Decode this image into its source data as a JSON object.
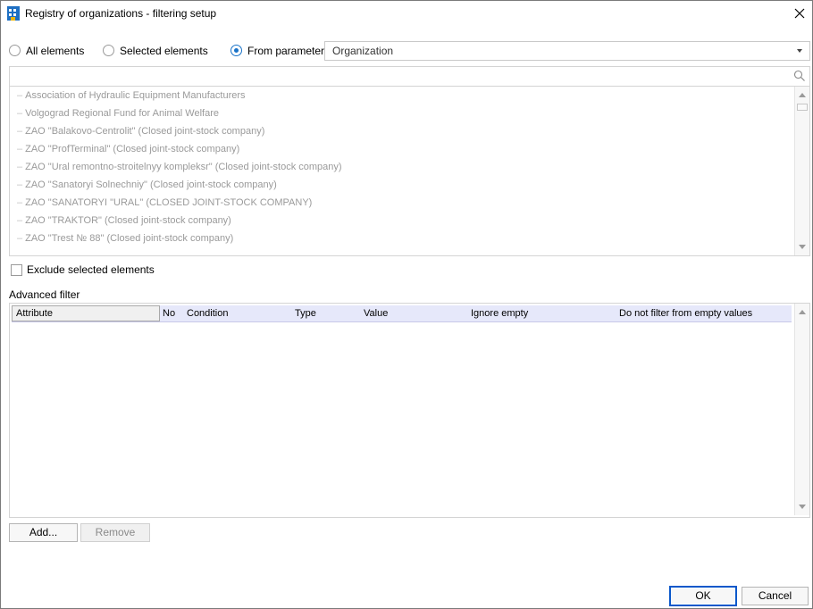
{
  "window": {
    "title": "Registry of organizations - filtering setup"
  },
  "selection_mode": {
    "options": [
      {
        "label": "All elements",
        "checked": false
      },
      {
        "label": "Selected elements",
        "checked": false
      },
      {
        "label": "From parameter:",
        "checked": true
      }
    ],
    "parameter_value": "Organization"
  },
  "search": {
    "placeholder": ""
  },
  "elements": [
    "Association of Hydraulic Equipment Manufacturers",
    "Volgograd Regional Fund for Animal Welfare",
    "ZAO \"Balakovo-Centrolit\" (Closed joint-stock company)",
    "ZAO \"ProfTerminal\" (Closed joint-stock company)",
    "ZAO \"Ural remontno-stroitelnyy kompleksr\" (Closed joint-stock company)",
    "ZAO \"Sanatoryi Solnechniy\" (Closed joint-stock company)",
    "ZAO \"SANATORYI \"URAL\" (CLOSED JOINT-STOCK COMPANY)",
    "ZAO \"TRAKTOR\" (Closed joint-stock company)",
    "ZAO \"Trest № 88\" (Closed joint-stock company)"
  ],
  "exclude": {
    "label": "Exclude selected elements",
    "checked": false
  },
  "advanced_filter": {
    "label": "Advanced filter",
    "columns": [
      "Attribute",
      "No",
      "Condition",
      "Type",
      "Value",
      "Ignore empty",
      "Do not filter from empty values"
    ],
    "rows": []
  },
  "buttons": {
    "add": "Add...",
    "remove": "Remove",
    "ok": "OK",
    "cancel": "Cancel"
  },
  "colors": {
    "accent": "#1a73c8",
    "header_bg": "#e6e8fa"
  }
}
